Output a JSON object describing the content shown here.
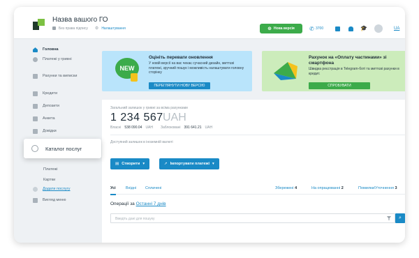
{
  "header": {
    "org_name": "Назва вашого ГО",
    "signature_status": "Без права підпису",
    "settings_link": "Налаштування",
    "new_version_label": "Нова версія",
    "phone": "3700",
    "lang": "UA"
  },
  "sidebar": {
    "items": [
      {
        "label": "Головна"
      },
      {
        "label": "Платежі у гривні"
      },
      {
        "label": "Рахунки та виписки"
      },
      {
        "label": "Кредити"
      },
      {
        "label": "Депозити"
      },
      {
        "label": "Анкета"
      },
      {
        "label": "Довідки"
      }
    ],
    "sub_items": [
      {
        "label": "Платежі"
      },
      {
        "label": "Картки"
      },
      {
        "label": "Додати послугу"
      }
    ],
    "view_menu": "Вигляд меню",
    "popup": "Каталог послуг"
  },
  "banner_update": {
    "badge": "NEW",
    "title": "Оцініть переваги оновлення",
    "text": "У новій версії на вас чекає сучасний дизайн, миттєві платежі, зручний пошук і можливість налаштувати головну сторінку",
    "button": "ПЕРЕГЛЯНУТИ НОВУ ВЕРСІЮ"
  },
  "banner_invoice": {
    "title": "Рахунок на «Оплату частинами» зі смартфона",
    "text": "Швидка реєстрація в Telegram-боті та миттєві рахунки в кредит.",
    "button": "СПРОБУВАТИ"
  },
  "balance": {
    "caption": "Загальний залишок у гривні за всіма рахунками",
    "amount": "1 234 567",
    "currency": "UAH",
    "own_label": "Власні",
    "own_value": "538 090.04",
    "own_cur": "UAH",
    "blocked_label": "Заблоковані",
    "blocked_value": "391 641.21",
    "blocked_cur": "UAH",
    "available_note": "Доступний залишок в іноземній валюті"
  },
  "actions": {
    "create": "Створити",
    "import": "Імпортувати платежі"
  },
  "tabs": {
    "all": "Усі",
    "incoming": "Вхідні",
    "paid": "Сплачені",
    "saved_label": "Збережені",
    "saved_count": "4",
    "processing_label": "На опрацюванні",
    "processing_count": "2",
    "errors_label": "Помилки/Уточнення",
    "errors_count": "3"
  },
  "operations": {
    "label": "Операції за",
    "period": "Останні 7 днів",
    "search_placeholder": "Введіть дані для пошуку"
  }
}
